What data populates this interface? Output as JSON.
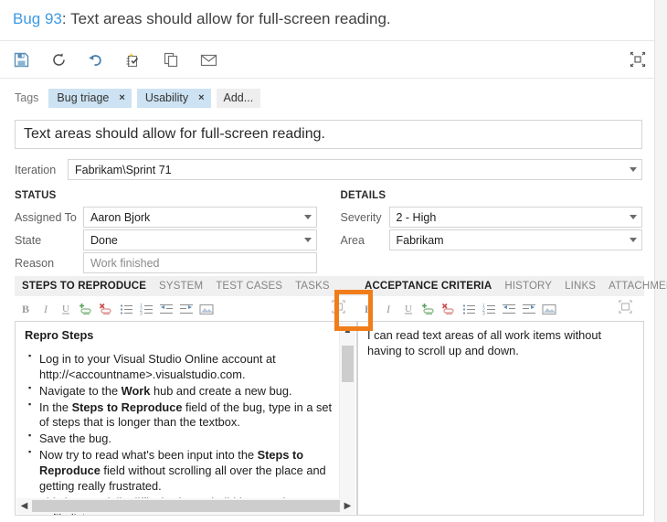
{
  "header": {
    "work_item_id": "Bug 93",
    "separator": ":",
    "title": "Text areas should allow for full-screen reading."
  },
  "toolbar": {
    "buttons": [
      {
        "name": "save-button",
        "label": "Save",
        "icon": "save-icon"
      },
      {
        "name": "refresh-button",
        "label": "Refresh",
        "icon": "refresh-icon"
      },
      {
        "name": "undo-button",
        "label": "Revert",
        "icon": "undo-icon"
      },
      {
        "name": "new-linked-item-button",
        "label": "New linked work item",
        "icon": "new-linked-item-icon"
      },
      {
        "name": "copy-button",
        "label": "Copy",
        "icon": "copy-icon"
      },
      {
        "name": "email-button",
        "label": "Send email",
        "icon": "email-icon"
      }
    ],
    "restore_button": {
      "name": "restore-down-button",
      "label": "Restore down",
      "icon": "restore-down-icon"
    }
  },
  "tags": {
    "label": "Tags",
    "items": [
      {
        "text": "Bug triage",
        "remove": "×"
      },
      {
        "text": "Usability",
        "remove": "×"
      }
    ],
    "add_label": "Add..."
  },
  "title_field": {
    "value": "Text areas should allow for full-screen reading."
  },
  "iteration": {
    "label": "Iteration",
    "value": "Fabrikam\\Sprint 71"
  },
  "status": {
    "heading": "STATUS",
    "fields": [
      {
        "label": "Assigned To",
        "value": "Aaron Bjork",
        "dropdown": true,
        "readonly": false
      },
      {
        "label": "State",
        "value": "Done",
        "dropdown": true,
        "readonly": false
      },
      {
        "label": "Reason",
        "value": "Work finished",
        "dropdown": false,
        "readonly": true
      }
    ]
  },
  "details": {
    "heading": "DETAILS",
    "fields": [
      {
        "label": "Severity",
        "value": "2 - High",
        "dropdown": true,
        "readonly": false
      },
      {
        "label": "Area",
        "value": "Fabrikam",
        "dropdown": true,
        "readonly": false
      }
    ]
  },
  "left_pane": {
    "tabs": [
      {
        "label": "STEPS TO REPRODUCE",
        "active": true
      },
      {
        "label": "SYSTEM",
        "active": false
      },
      {
        "label": "TEST CASES",
        "active": false
      },
      {
        "label": "TASKS",
        "active": false
      }
    ],
    "content_heading": "Repro Steps",
    "bullets": [
      "Log in to your Visual Studio Online account at http://<accountname>.visualstudio.com.",
      "Navigate to the Work hub and create a new bug.",
      "In the Steps to Reproduce field of the bug, type in a set of steps that is longer than the textbox.",
      "Save the bug.",
      "Now try to read what's been input into the Steps to Reproduce field without scrolling all over the place and getting really frustrated.",
      "This is especially difficult when a build log, stack trace, or file list"
    ]
  },
  "right_pane": {
    "tabs": [
      {
        "label": "ACCEPTANCE CRITERIA",
        "active": true
      },
      {
        "label": "HISTORY",
        "active": false
      },
      {
        "label": "LINKS",
        "active": false
      },
      {
        "label": "ATTACHMENT",
        "active": false
      }
    ],
    "content": "I can read text areas of all work items without having to scroll up and down."
  },
  "editor_toolbar": {
    "buttons": [
      {
        "name": "bold-button",
        "label": "B"
      },
      {
        "name": "italic-button",
        "label": "I"
      },
      {
        "name": "underline-button",
        "label": "U"
      },
      {
        "name": "insert-link-button",
        "label": "Insert link"
      },
      {
        "name": "remove-link-button",
        "label": "Remove link"
      },
      {
        "name": "bullet-list-button",
        "label": "Bulleted list"
      },
      {
        "name": "numbered-list-button",
        "label": "Numbered list"
      },
      {
        "name": "outdent-button",
        "label": "Decrease indent"
      },
      {
        "name": "indent-button",
        "label": "Increase indent"
      },
      {
        "name": "insert-image-button",
        "label": "Insert image"
      }
    ],
    "maximize_label": "Maximize text area"
  },
  "highlight": {
    "color": "#f07d19",
    "target": "maximize-button"
  },
  "colors": {
    "link_blue": "#3d9ae2",
    "tag_bg": "#cde3f3",
    "tab_strip_bg": "#f0f0f0",
    "highlight_orange": "#f07d19",
    "border_gray": "#d4d4d4"
  }
}
